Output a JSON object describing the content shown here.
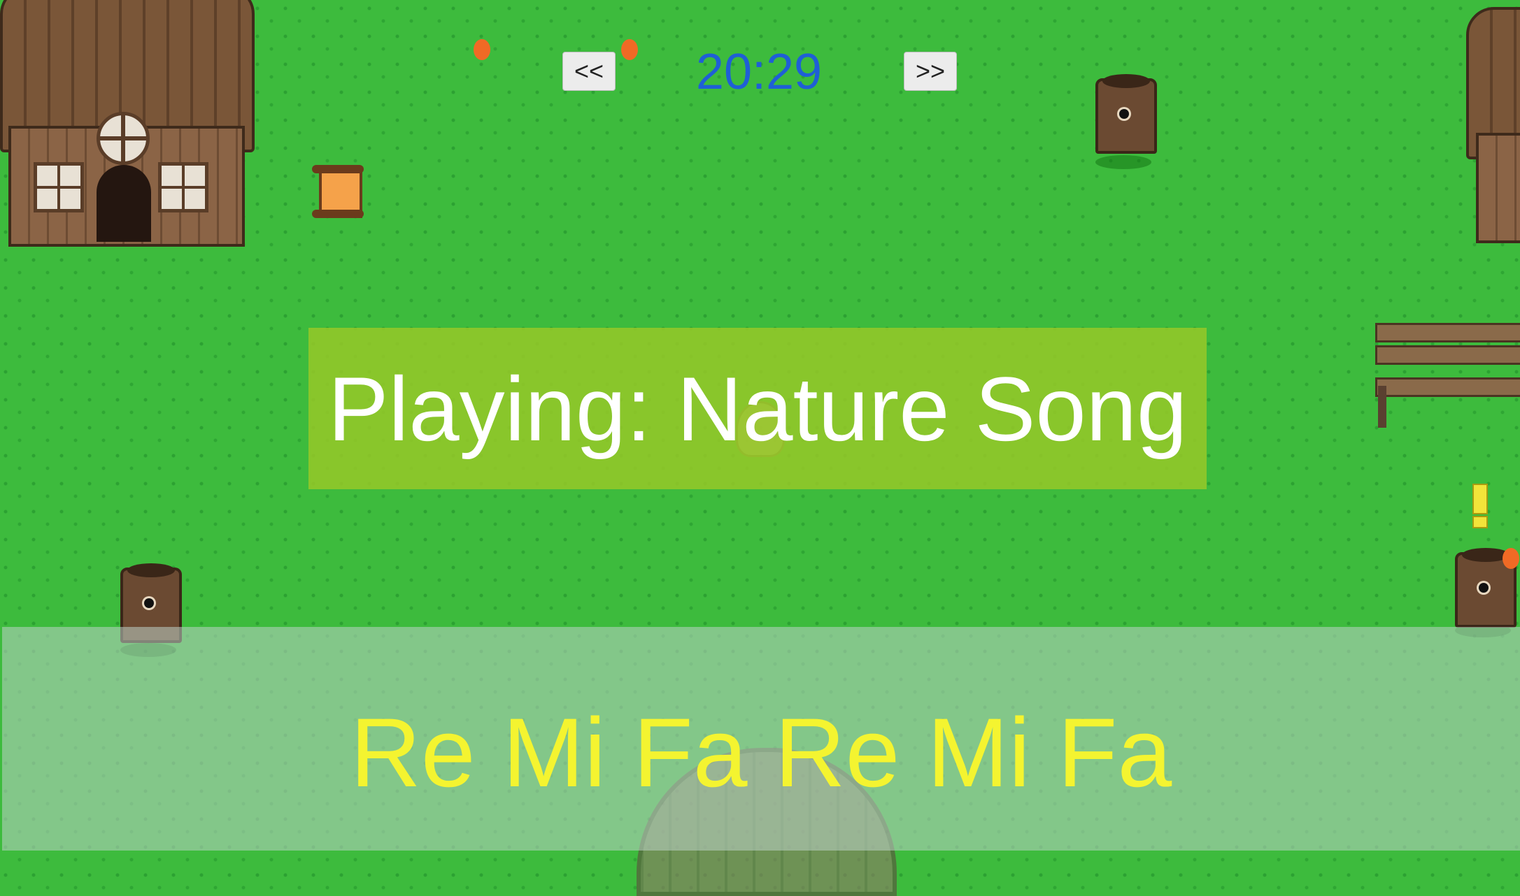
{
  "hud": {
    "prev_label": "<<",
    "next_label": ">>",
    "clock": "20:29"
  },
  "banner": {
    "now_playing": "Playing: Nature Song"
  },
  "notes": {
    "text": "Re Mi Fa Re Mi Fa"
  },
  "colors": {
    "grass": "#3dbb3d",
    "clock_text": "#1f5fd6",
    "notes_text": "#f4f430",
    "banner_bg": "#96c828"
  },
  "sprites": [
    "house",
    "house-right-edge",
    "tree-stump-npc",
    "tree-stump-npc",
    "tree-stump-npc",
    "bench",
    "scroll-item",
    "exclamation-marker",
    "player",
    "well",
    "orange-fruit"
  ]
}
